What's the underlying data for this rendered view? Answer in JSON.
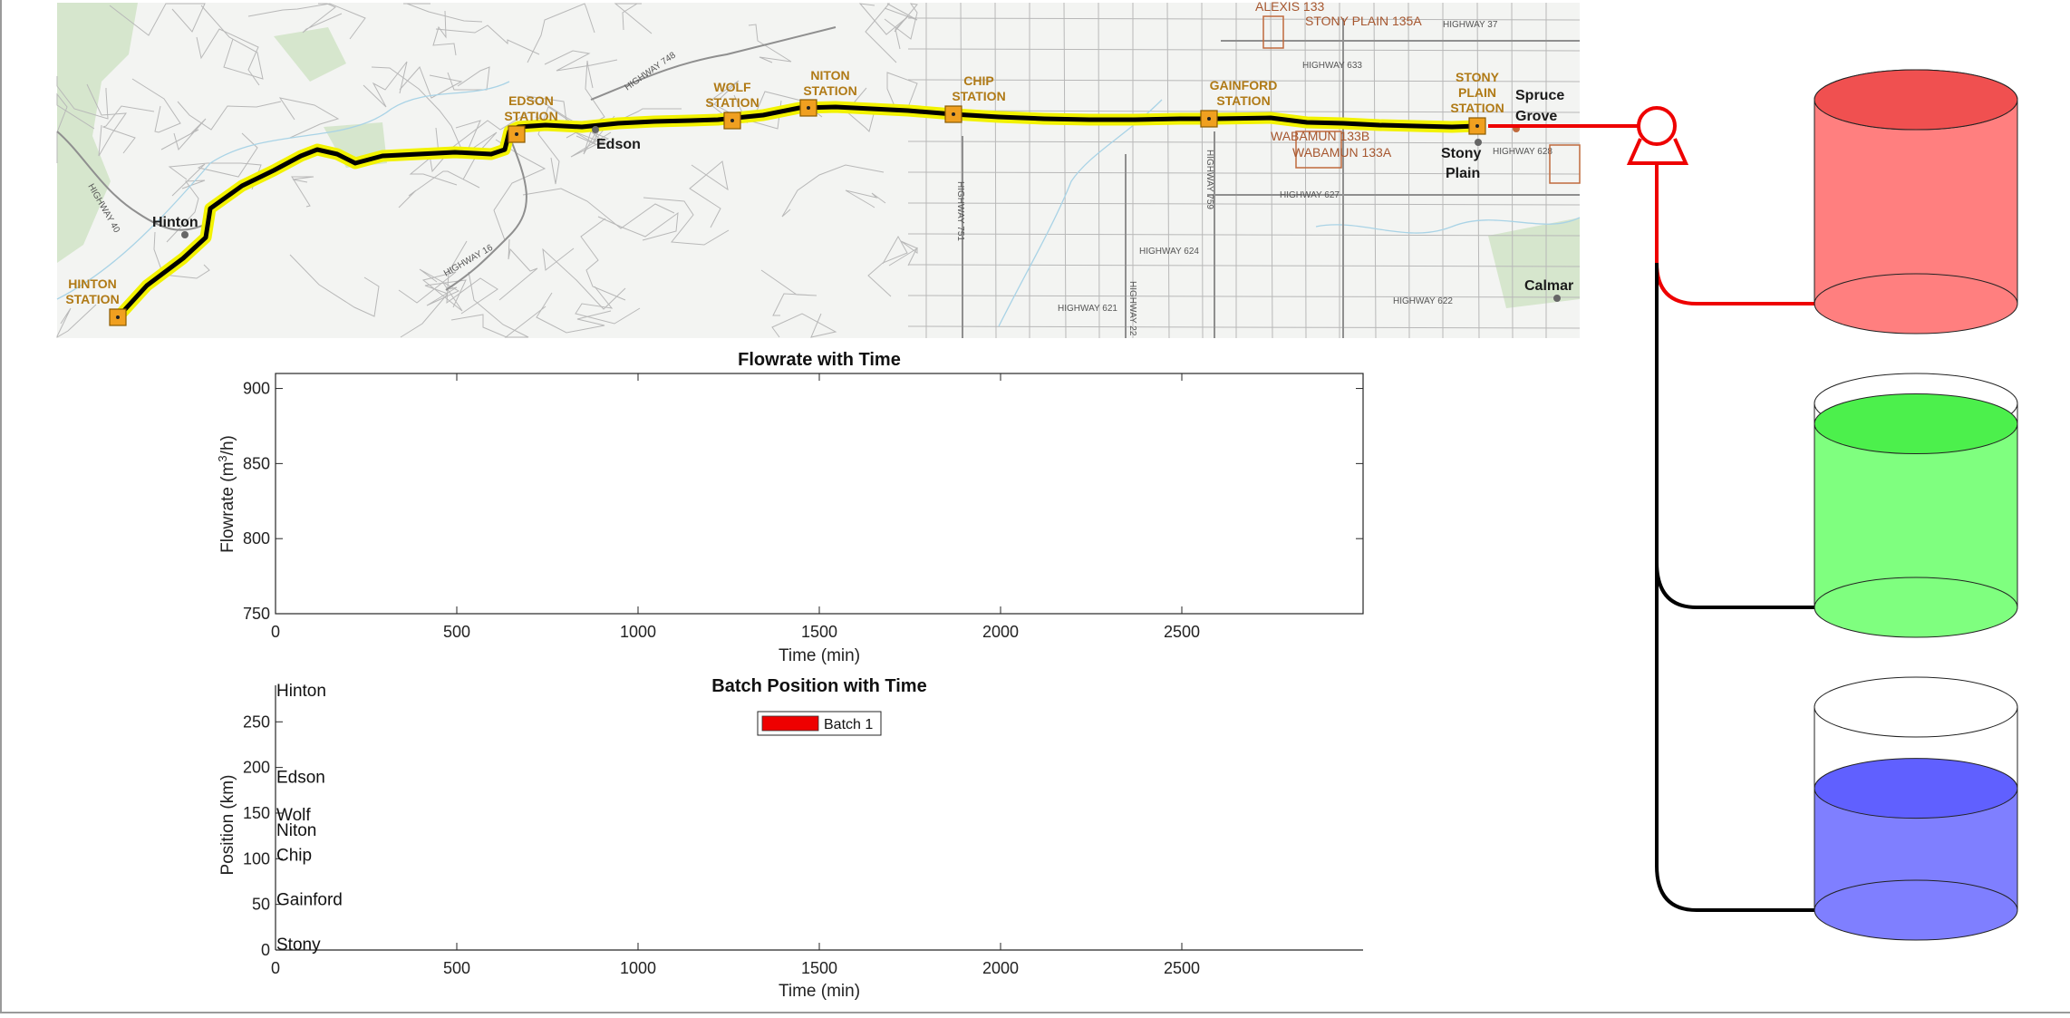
{
  "colors": {
    "pipeline_red": "#ee0000",
    "tank1_fill": "#ff7f7f",
    "tank2_fill": "#7fff7f",
    "tank3_fill": "#7f7fff",
    "station_orange": "#f0a020",
    "route_yellow": "#f2f200"
  },
  "map": {
    "stations": [
      "HINTON STATION",
      "EDSON STATION",
      "WOLF STATION",
      "NITON STATION",
      "CHIP STATION",
      "GAINFORD STATION",
      "STONY PLAIN STATION"
    ],
    "towns": [
      "Hinton",
      "Edson",
      "Spruce Grove",
      "Stony Plain",
      "Calmar"
    ],
    "reserves": [
      "ALEXIS 133",
      "STONY PLAIN 135A",
      "WABAMUN 133B",
      "WABAMUN 133A"
    ],
    "highways": [
      "HIGHWAY 40",
      "HIGHWAY 748",
      "HIGHWAY 16",
      "HIGHWAY 751",
      "HIGHWAY 759",
      "HIGHWAY 633",
      "HIGHWAY 37",
      "HIGHWAY 628",
      "HIGHWAY 627",
      "HIGHWAY 624",
      "HIGHWAY 621",
      "HIGHWAY 622",
      "HIGHWAY 22"
    ]
  },
  "chart_data": [
    {
      "type": "line",
      "title": "Flowrate with Time",
      "xlabel": "Time (min)",
      "ylabel": "Flowrate (m3/h)",
      "xlim": [
        0,
        3000
      ],
      "ylim": [
        750,
        910
      ],
      "xticks": [
        0,
        500,
        1000,
        1500,
        2000,
        2500
      ],
      "yticks": [
        750,
        800,
        850,
        900
      ],
      "grid": false,
      "series": []
    },
    {
      "type": "area",
      "title": "Batch Position with Time",
      "xlabel": "Time (min)",
      "ylabel": "Position (km)",
      "xlim": [
        0,
        3000
      ],
      "ylim": [
        0,
        290
      ],
      "xticks": [
        0,
        500,
        1000,
        1500,
        2000,
        2500
      ],
      "yticks": [
        0,
        50,
        100,
        150,
        200,
        250
      ],
      "grid": false,
      "legend_position": "top-center",
      "series": [
        {
          "name": "Batch 1",
          "color": "#ee0000",
          "values": []
        }
      ],
      "station_labels": [
        {
          "name": "Hinton",
          "km": 285
        },
        {
          "name": "Edson",
          "km": 190
        },
        {
          "name": "Wolf",
          "km": 149
        },
        {
          "name": "Niton",
          "km": 132
        },
        {
          "name": "Chip",
          "km": 105
        },
        {
          "name": "Gainford",
          "km": 56
        },
        {
          "name": "Stony",
          "km": 7
        }
      ]
    }
  ],
  "tanks": [
    {
      "name": "tank-1",
      "fill_fraction": 1.0,
      "fill_color": "#ff7f7f",
      "top_color": "#f05050"
    },
    {
      "name": "tank-2",
      "fill_fraction": 0.9,
      "fill_color": "#7fff7f",
      "top_color": "#4cf04c"
    },
    {
      "name": "tank-3",
      "fill_fraction": 0.6,
      "fill_color": "#7f7fff",
      "top_color": "#6060ff"
    }
  ]
}
